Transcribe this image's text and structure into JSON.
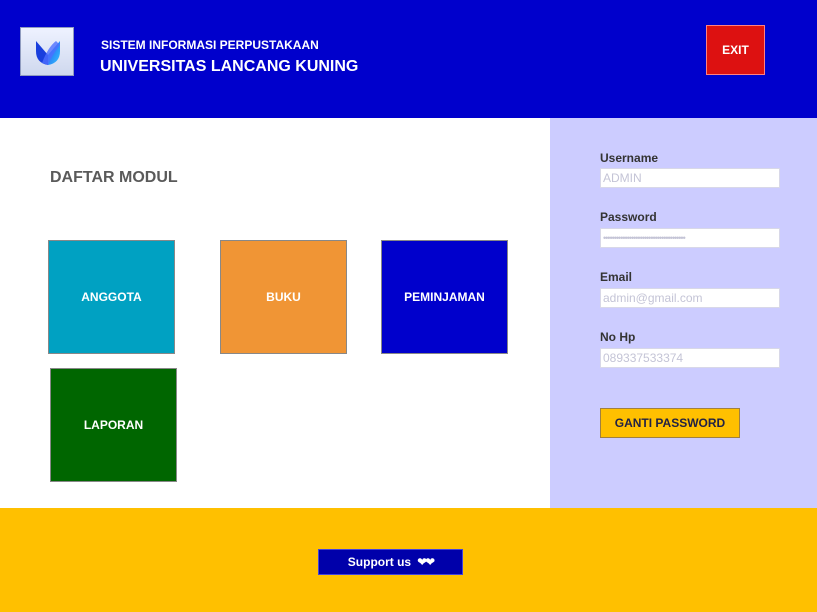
{
  "header": {
    "subtitle": "SISTEM INFORMASI PERPUSTAKAAN",
    "title": "UNIVERSITAS LANCANG KUNING",
    "exit_label": "EXIT",
    "logo_icon": "app-logo-icon"
  },
  "main": {
    "heading": "DAFTAR MODUL",
    "modules": [
      {
        "label": "ANGGOTA",
        "color": "#00a1c2"
      },
      {
        "label": "BUKU",
        "color": "#f09535"
      },
      {
        "label": "PEMINJAMAN",
        "color": "#0000cc"
      },
      {
        "label": "LAPORAN",
        "color": "#006600"
      }
    ]
  },
  "account": {
    "username_label": "Username",
    "username_value": "ADMIN",
    "password_label": "Password",
    "password_mask": "••••••••••••••••••••••••••••••••••••••",
    "email_label": "Email",
    "email_value": "admin@gmail.com",
    "phone_label": "No Hp",
    "phone_value": "089337533374",
    "change_password_label": "GANTI PASSWORD"
  },
  "footer": {
    "support_label": "Support us",
    "support_hearts": "❤❤"
  },
  "colors": {
    "header_bg": "#0000cc",
    "side_bg": "#ccccff",
    "footer_bg": "#ffc000",
    "exit_bg": "#dd1111"
  }
}
